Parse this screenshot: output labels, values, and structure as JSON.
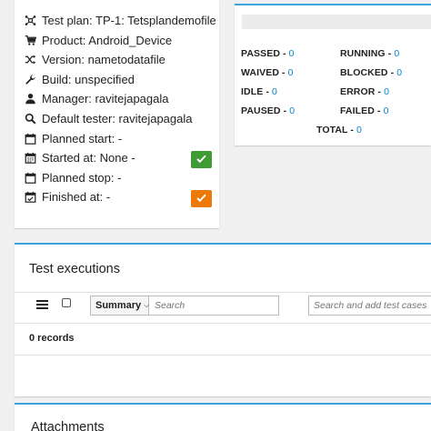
{
  "info": {
    "test_plan": "Test plan: TP-1: Tetsplandemofile",
    "product": "Product: Android_Device",
    "version": "Version: nametodatafile",
    "build": "Build: unspecified",
    "manager": "Manager: ravitejapagala",
    "default_tester": "Default tester: ravitejapagala",
    "planned_start": "Planned start: -",
    "started_at": "Started at: None -",
    "planned_stop": "Planned stop: -",
    "finished_at": "Finished at: -",
    "colors": {
      "start_button": "#3f9c35",
      "finish_button": "#ec7a08"
    }
  },
  "statuses": {
    "passed_label": "PASSED - ",
    "passed_value": "0",
    "running_label": "RUNNING - ",
    "running_value": "0",
    "waived_label": "WAIVED - ",
    "waived_value": "0",
    "blocked_label": "BLOCKED - ",
    "blocked_value": "0",
    "idle_label": "IDLE - ",
    "idle_value": "0",
    "error_label": "ERROR - ",
    "error_value": "0",
    "paused_label": "PAUSED - ",
    "paused_value": "0",
    "failed_label": "FAILED - ",
    "failed_value": "0",
    "total_label": "TOTAL - ",
    "total_value": "0"
  },
  "executions": {
    "title": "Test executions",
    "filter_field": "Summary",
    "search_placeholder": "Search",
    "add_placeholder": "Search and add test cases",
    "records": "0 records"
  },
  "attachments": {
    "title": "Attachments"
  }
}
